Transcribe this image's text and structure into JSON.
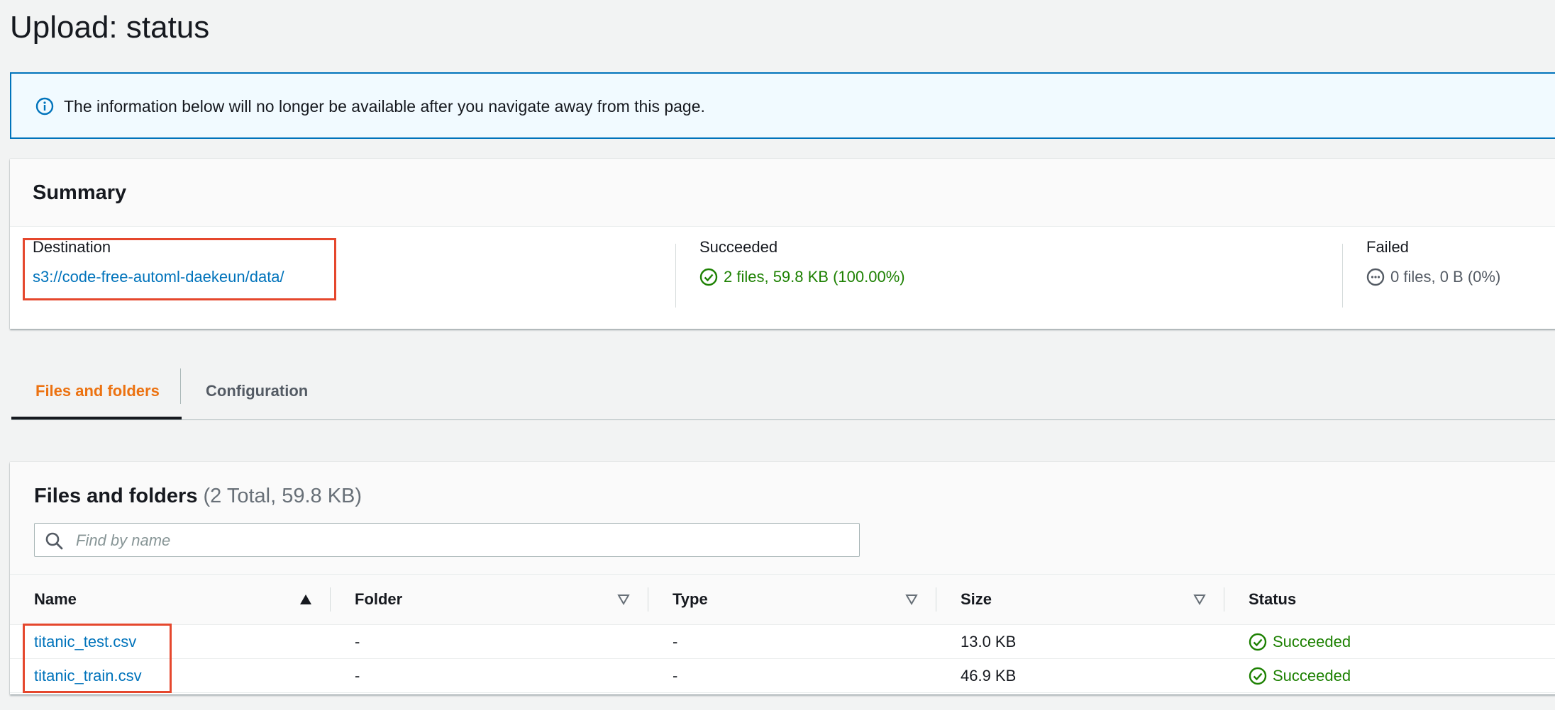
{
  "page": {
    "title": "Upload: status"
  },
  "banner": {
    "text": "The information below will no longer be available after you navigate away from this page."
  },
  "summary": {
    "title": "Summary",
    "destination_label": "Destination",
    "destination_value": "s3://code-free-automl-daekeun/data/",
    "succeeded_label": "Succeeded",
    "succeeded_value": "2 files, 59.8 KB (100.00%)",
    "failed_label": "Failed",
    "failed_value": "0 files, 0 B (0%)"
  },
  "tabs": [
    {
      "label": "Files and folders",
      "active": true
    },
    {
      "label": "Configuration",
      "active": false
    }
  ],
  "files": {
    "title": "Files and folders",
    "count": "(2 Total, 59.8 KB)",
    "search_placeholder": "Find by name",
    "columns": [
      "Name",
      "Folder",
      "Type",
      "Size",
      "Status"
    ],
    "rows": [
      {
        "name": "titanic_test.csv",
        "folder": "-",
        "type": "-",
        "size": "13.0 KB",
        "status": "Succeeded"
      },
      {
        "name": "titanic_train.csv",
        "folder": "-",
        "type": "-",
        "size": "46.9 KB",
        "status": "Succeeded"
      }
    ]
  },
  "colors": {
    "accent": "#ec7211",
    "link": "#0073bb",
    "success": "#1d8102",
    "highlight": "#e5472d",
    "info_border": "#0073bb"
  },
  "icons": {
    "info": "info-icon",
    "success": "check-circle-icon",
    "failed": "dots-circle-icon",
    "search": "search-icon",
    "sort_asc": "caret-up-icon",
    "sort_none": "caret-down-outline-icon"
  }
}
